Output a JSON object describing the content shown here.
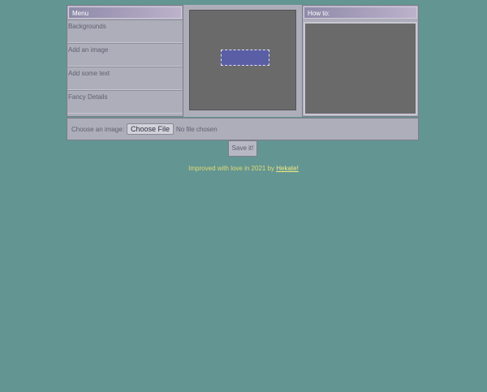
{
  "menu": {
    "title": "Menu",
    "items": [
      {
        "label": "Backgrounds"
      },
      {
        "label": "Add an image"
      },
      {
        "label": "Add some text"
      },
      {
        "label": "Fancy Details"
      }
    ]
  },
  "howto": {
    "title": "How to:"
  },
  "upload": {
    "label": "Choose an image:",
    "button_label": "Choose File",
    "status": "No file chosen"
  },
  "save": {
    "label": "Save it!"
  },
  "credit": {
    "text": "Improved with love in 2021 by",
    "link": "Hekate!"
  },
  "colors": {
    "background": "#639593",
    "panel": "#aeaeba",
    "canvas": "#6a6a6a",
    "selection": "#5a5ea4",
    "credit_text": "#e2dc70"
  }
}
